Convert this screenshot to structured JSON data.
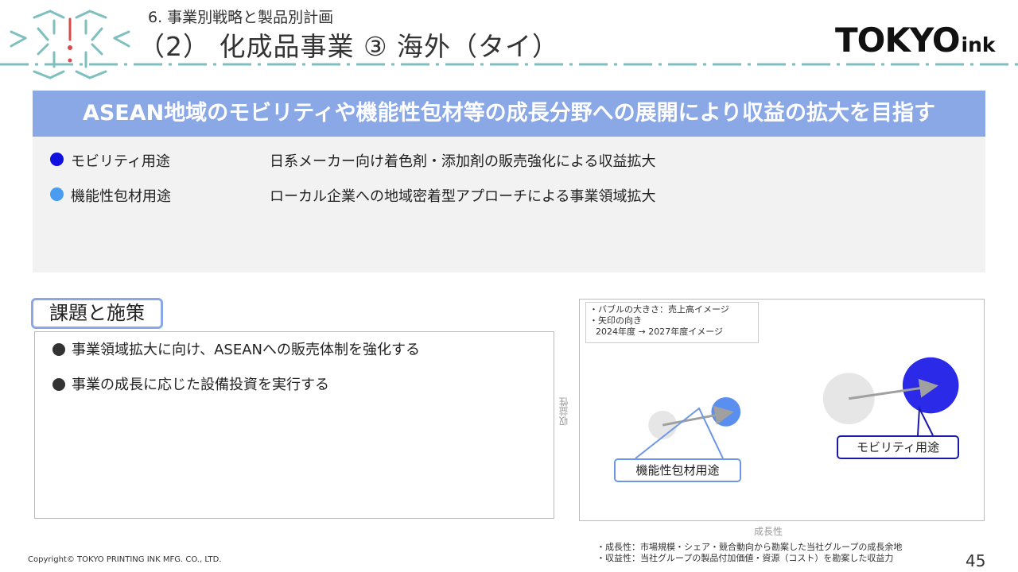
{
  "header": {
    "section_label": "6. 事業別戦略と製品別計画",
    "title": "（2） 化成品事業  ③ 海外（タイ）",
    "brand_main": "TOKYO",
    "brand_sub": "ink"
  },
  "banner": {
    "text": "ASEAN地域のモビリティや機能性包材等の成長分野への展開により収益の拡大を目指す"
  },
  "strategy": {
    "rows": [
      {
        "label": "モビリティ用途",
        "description": "日系メーカー向け着色剤・添加剤の販売強化による収益拡大",
        "dot_color": "#1010e0"
      },
      {
        "label": "機能性包材用途",
        "description": "ローカル企業への地域密着型アプローチによる事業領域拡大",
        "dot_color": "#4a9cf0"
      }
    ]
  },
  "issues": {
    "tab_label": "課題と施策",
    "items": [
      "事業領域拡大に向け、ASEANへの販売体制を強化する",
      "事業の成長に応じた設備投資を実行する"
    ]
  },
  "chart_legend_note": {
    "line1": "・バブルの大きさ：売上高イメージ",
    "line2": "・矢印の向き",
    "line3": "2024年度  →  2027年度イメージ"
  },
  "chart_data": {
    "type": "scatter",
    "xlabel": "成長性",
    "ylabel": "収益性",
    "series": [
      {
        "name": "機能性包材用途",
        "from": {
          "x": 0.18,
          "y": 0.42
        },
        "to": {
          "x": 0.35,
          "y": 0.49
        },
        "size_from": 0.5,
        "size_to": 0.75,
        "color_from": "#e6e6e6",
        "color_to": "#5a8ff0",
        "label_color": "#6d95e8"
      },
      {
        "name": "モビリティ用途",
        "from": {
          "x": 0.68,
          "y": 0.56
        },
        "to": {
          "x": 0.9,
          "y": 0.63
        },
        "size_from": 0.9,
        "size_to": 1.0,
        "color_from": "#e6e6e6",
        "color_to": "#2a2ae8",
        "label_color": "#1a1aa8"
      }
    ],
    "arrow_color": "#a0a0a0"
  },
  "footer": {
    "note1": "・成長性：市場規模・シェア・競合動向から勘案した当社グループの成長余地",
    "note2": "・収益性：当社グループの製品付加価値・資源（コスト）を勘案した収益力",
    "copyright": "Copyright© TOKYO PRINTING INK MFG. CO., LTD.",
    "page_number": "45"
  }
}
